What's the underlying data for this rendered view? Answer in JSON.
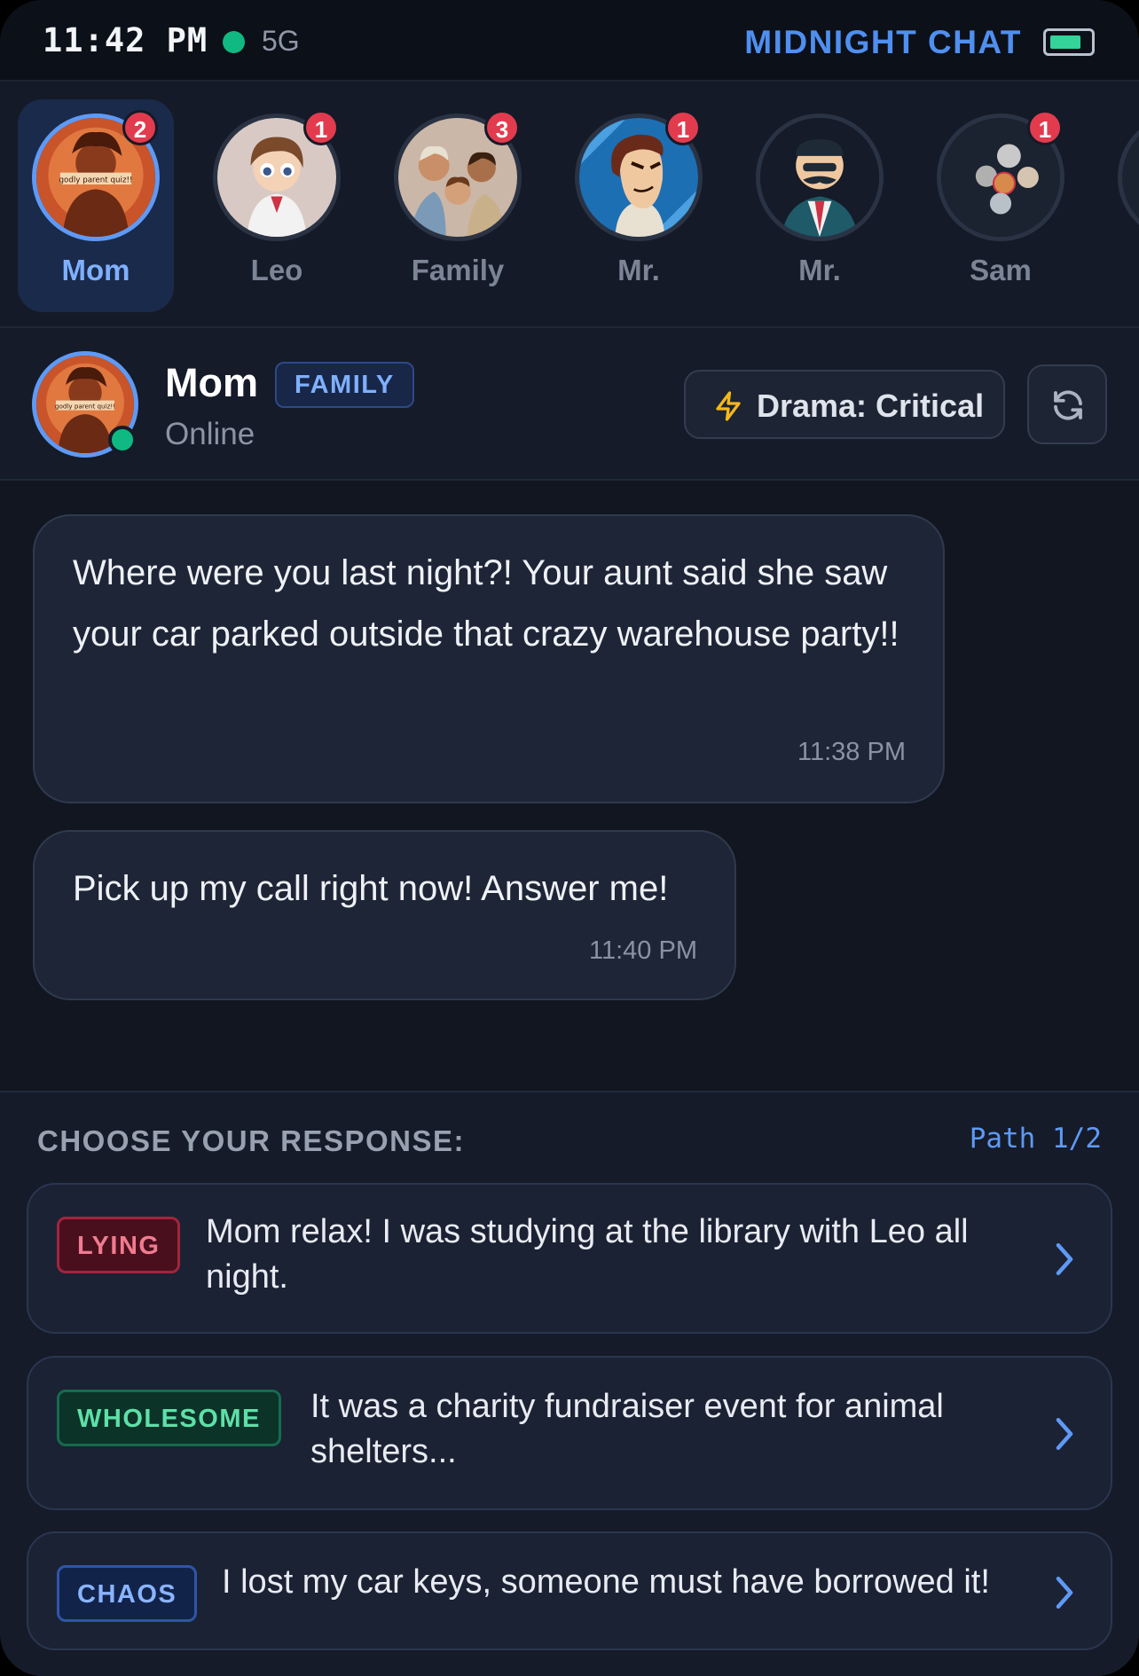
{
  "status_bar": {
    "time": "11:42 PM",
    "network": "5G",
    "app_title": "MIDNIGHT CHAT",
    "battery_level": 0.8
  },
  "contacts": [
    {
      "name": "Mom",
      "badge": "2",
      "active": true,
      "avatar_text": "godly parent quiz!!"
    },
    {
      "name": "Leo",
      "badge": "1",
      "active": false
    },
    {
      "name": "Family",
      "badge": "3",
      "active": false
    },
    {
      "name": "Mr.",
      "badge": "1",
      "active": false
    },
    {
      "name": "Mr.",
      "badge": "",
      "active": false
    },
    {
      "name": "Sam",
      "badge": "1",
      "active": false
    }
  ],
  "chat_header": {
    "name": "Mom",
    "tag": "FAMILY",
    "status": "Online",
    "drama": "Drama: Critical",
    "avatar_text": "godly parent quiz!!"
  },
  "messages": [
    {
      "text": "Where were you last night?! Your aunt said she saw your car parked outside that crazy warehouse party!!",
      "time": "11:38 PM"
    },
    {
      "text": "Pick up my call right now! Answer me!",
      "time": "11:40 PM"
    }
  ],
  "response_panel": {
    "label": "CHOOSE YOUR RESPONSE:",
    "path": "Path 1/2",
    "options": [
      {
        "tag": "LYING",
        "text": "Mom relax! I was studying at the library with Leo all night."
      },
      {
        "tag": "WHOLESOME",
        "text": "It was a charity fundraiser event for animal shelters..."
      },
      {
        "tag": "CHAOS",
        "text": "I lost my car keys, someone must have borrowed it!"
      }
    ]
  },
  "colors": {
    "accent": "#5e9af5",
    "online": "#10b981",
    "badge": "#e23b4e",
    "lightning": "#f5b81c"
  },
  "icons": [
    "lightning-icon",
    "refresh-icon",
    "chevron-right-icon"
  ]
}
